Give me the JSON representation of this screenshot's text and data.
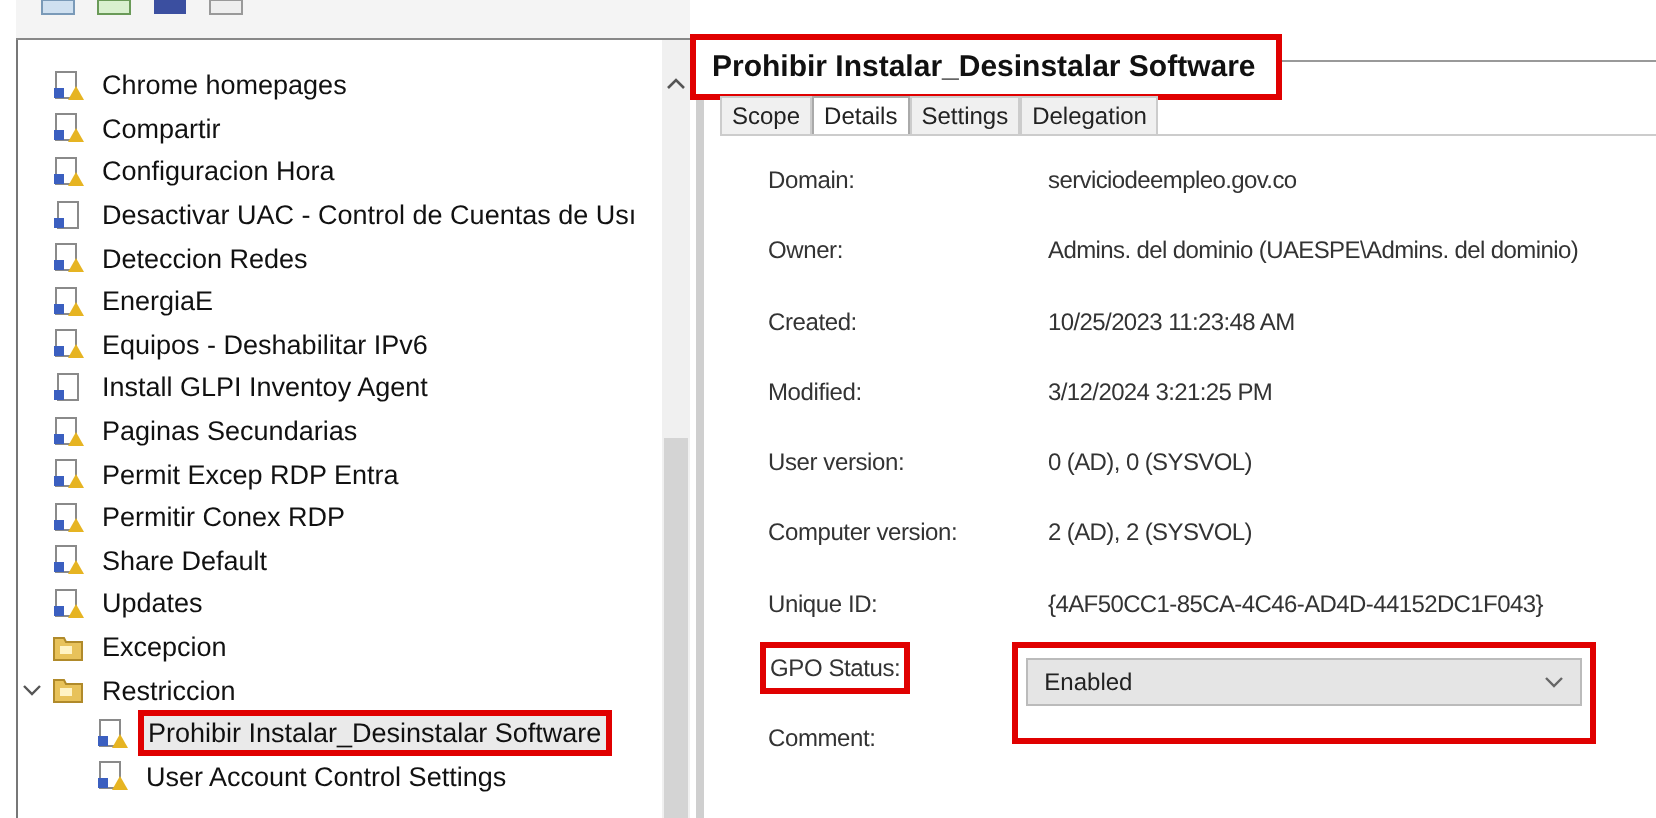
{
  "tree": [
    {
      "label": "Chrome homepages",
      "kind": "enforced-link",
      "selected": false,
      "highlighted": false
    },
    {
      "label": "Compartir",
      "kind": "enforced-link",
      "selected": false,
      "highlighted": false
    },
    {
      "label": "Configuracion Hora",
      "kind": "enforced-link",
      "selected": false,
      "highlighted": false
    },
    {
      "label": "Desactivar UAC - Control de Cuentas de Usı",
      "kind": "link",
      "selected": false,
      "highlighted": false
    },
    {
      "label": "Deteccion Redes",
      "kind": "enforced-link",
      "selected": false,
      "highlighted": false
    },
    {
      "label": "EnergiaE",
      "kind": "enforced-link",
      "selected": false,
      "highlighted": false
    },
    {
      "label": "Equipos - Deshabilitar IPv6",
      "kind": "enforced-link",
      "selected": false,
      "highlighted": false
    },
    {
      "label": "Install GLPI Inventoy Agent",
      "kind": "link",
      "selected": false,
      "highlighted": false
    },
    {
      "label": "Paginas Secundarias",
      "kind": "enforced-link",
      "selected": false,
      "highlighted": false
    },
    {
      "label": "Permit Excep RDP Entra",
      "kind": "enforced-link",
      "selected": false,
      "highlighted": false
    },
    {
      "label": "Permitir Conex RDP",
      "kind": "enforced-link",
      "selected": false,
      "highlighted": false
    },
    {
      "label": "Share Default",
      "kind": "enforced-link",
      "selected": false,
      "highlighted": false
    },
    {
      "label": "Updates",
      "kind": "enforced-link",
      "selected": false,
      "highlighted": false
    },
    {
      "label": "Excepcion",
      "kind": "ou",
      "selected": false,
      "highlighted": false
    },
    {
      "label": "Restriccion",
      "kind": "ou",
      "selected": false,
      "highlighted": false,
      "expanded": true,
      "children": [
        {
          "label": "Prohibir Instalar_Desinstalar Software",
          "kind": "enforced-link",
          "selected": true,
          "highlighted": true
        },
        {
          "label": "User Account Control Settings",
          "kind": "enforced-link",
          "selected": false,
          "highlighted": false
        }
      ]
    }
  ],
  "panel": {
    "title": "Prohibir Instalar_Desinstalar Software",
    "title_highlighted": true,
    "tabs": [
      {
        "label": "Scope",
        "selected": false
      },
      {
        "label": "Details",
        "selected": true
      },
      {
        "label": "Settings",
        "selected": false
      },
      {
        "label": "Delegation",
        "selected": false
      }
    ],
    "details": [
      {
        "label": "Domain:",
        "value": "serviciodeempleo.gov.co"
      },
      {
        "label": "Owner:",
        "value": "Admins. del dominio (UAESPE\\Admins. del dominio)"
      },
      {
        "label": "Created:",
        "value": "10/25/2023 11:23:48 AM"
      },
      {
        "label": "Modified:",
        "value": "3/12/2024 3:21:25 PM"
      },
      {
        "label": "User version:",
        "value": "0 (AD), 0 (SYSVOL)"
      },
      {
        "label": "Computer version:",
        "value": "2 (AD), 2 (SYSVOL)"
      },
      {
        "label": "Unique ID:",
        "value": "{4AF50CC1-85CA-4C46-AD4D-44152DC1F043}"
      }
    ],
    "gpo_status": {
      "label": "GPO Status:",
      "value": "Enabled",
      "highlighted": true
    },
    "comment": {
      "label": "Comment:"
    }
  }
}
